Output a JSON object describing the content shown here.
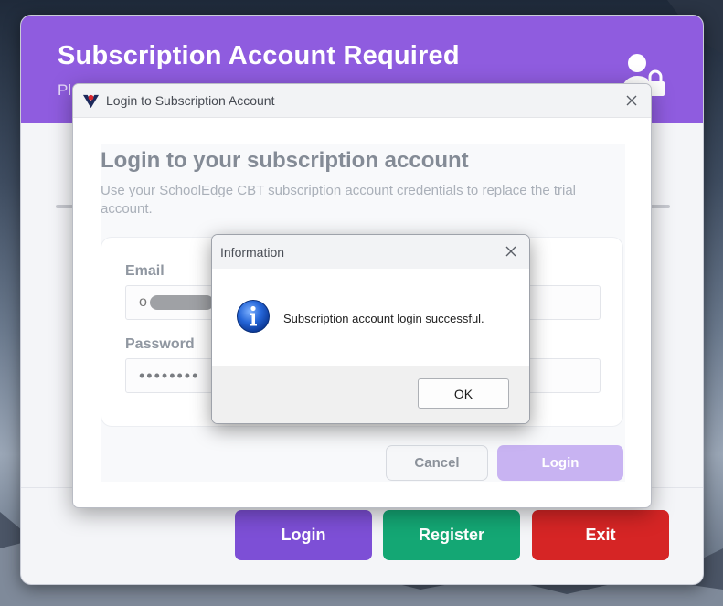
{
  "main_window": {
    "title": "Subscription Account Required",
    "subtitle": "Pl",
    "buttons": {
      "login": "Login",
      "register": "Register",
      "exit": "Exit"
    }
  },
  "login_dialog": {
    "window_title": "Login to Subscription Account",
    "heading": "Login to your subscription account",
    "description": "Use your SchoolEdge CBT subscription account credentials to replace the trial account.",
    "email_label": "Email",
    "email_value": "o",
    "password_label": "Password",
    "password_value": "••••••••",
    "cancel_label": "Cancel",
    "login_label": "Login"
  },
  "info_box": {
    "title": "Information",
    "message": "Subscription account login successful.",
    "ok_label": "OK"
  },
  "icons": {
    "header": "user-lock-icon",
    "app_logo": "app-logo-icon",
    "close": "close-icon",
    "info": "info-icon"
  },
  "colors": {
    "header_purple": "#8f5cdf",
    "login_button": "#7d4fd6",
    "register_button": "#14a774",
    "exit_button": "#d62525",
    "dialog_login_button": "#c8b3f2"
  }
}
